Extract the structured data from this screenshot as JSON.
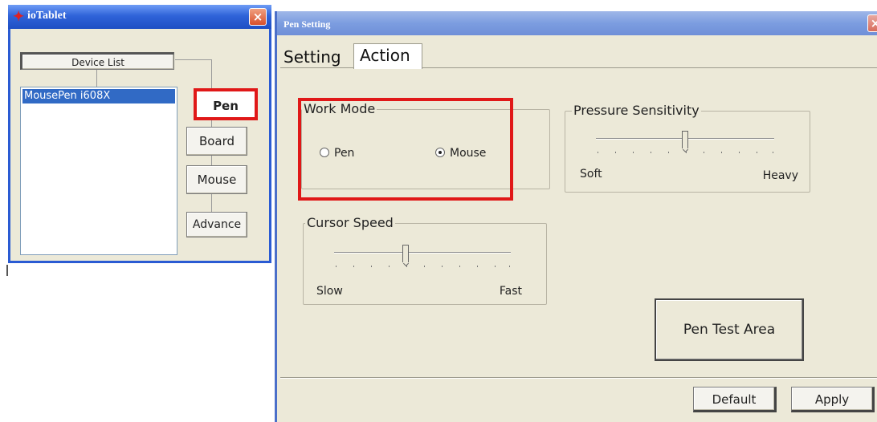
{
  "iotablet": {
    "title": "ioTablet",
    "close_label": "×",
    "device_list_label": "Device List",
    "devices": [
      "MousePen i608X"
    ],
    "buttons": {
      "pen": "Pen",
      "board": "Board",
      "mouse": "Mouse",
      "advance": "Advance"
    }
  },
  "pen_setting": {
    "title": "Pen Setting",
    "close_label": "×",
    "tabs": [
      "Setting",
      "Action"
    ],
    "work_mode": {
      "label": "Work Mode",
      "options": [
        "Pen",
        "Mouse"
      ],
      "selected": "Mouse"
    },
    "pressure_sensitivity": {
      "label": "Pressure Sensitivity",
      "min_label": "Soft",
      "max_label": "Heavy",
      "value": 0.5
    },
    "cursor_speed": {
      "label": "Cursor Speed",
      "min_label": "Slow",
      "max_label": "Fast",
      "value": 0.4
    },
    "pen_test_area": "Pen Test Area",
    "buttons": {
      "default": "Default",
      "apply": "Apply"
    }
  },
  "colors": {
    "highlight_red": "#e01818",
    "selection_blue": "#316ac5",
    "dialog_bg": "#ece9d8"
  }
}
